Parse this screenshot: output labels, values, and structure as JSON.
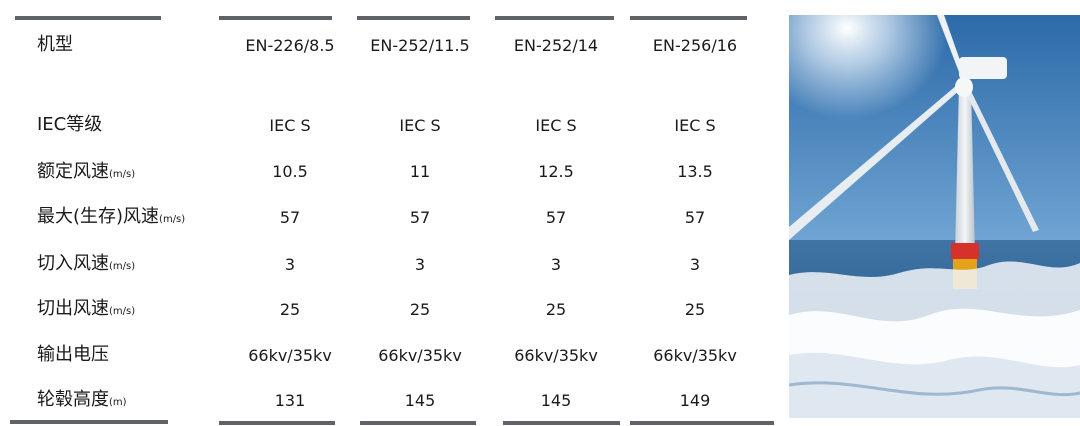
{
  "table": {
    "header": {
      "label": "机型",
      "models": [
        "EN-226/8.5",
        "EN-252/11.5",
        "EN-252/14",
        "EN-256/16"
      ]
    },
    "rows": [
      {
        "label": "IEC等级",
        "unit": "",
        "values": [
          "IEC S",
          "IEC S",
          "IEC S",
          "IEC S"
        ]
      },
      {
        "label": "额定风速",
        "unit": "(m/s)",
        "values": [
          "10.5",
          "11",
          "12.5",
          "13.5"
        ]
      },
      {
        "label": "最大(生存)风速",
        "unit": "(m/s)",
        "values": [
          "57",
          "57",
          "57",
          "57"
        ]
      },
      {
        "label": "切入风速",
        "unit": "(m/s)",
        "values": [
          "3",
          "3",
          "3",
          "3"
        ]
      },
      {
        "label": "切出风速",
        "unit": "(m/s)",
        "values": [
          "25",
          "25",
          "25",
          "25"
        ]
      },
      {
        "label": "输出电压",
        "unit": "",
        "values": [
          "66kv/35kv",
          "66kv/35kv",
          "66kv/35kv",
          "66kv/35kv"
        ]
      },
      {
        "label": "轮毂高度",
        "unit": "(m)",
        "values": [
          "131",
          "145",
          "145",
          "149"
        ]
      }
    ]
  },
  "photo": {
    "subject": "offshore-wind-turbine",
    "colors": {
      "sky_top": "#2f6fae",
      "sky_bottom": "#a9cbe6",
      "sea": "#2d5f8f",
      "foam": "#f3f7fb",
      "tower": "#e9edf1",
      "foundation": "#e2a21a"
    }
  }
}
